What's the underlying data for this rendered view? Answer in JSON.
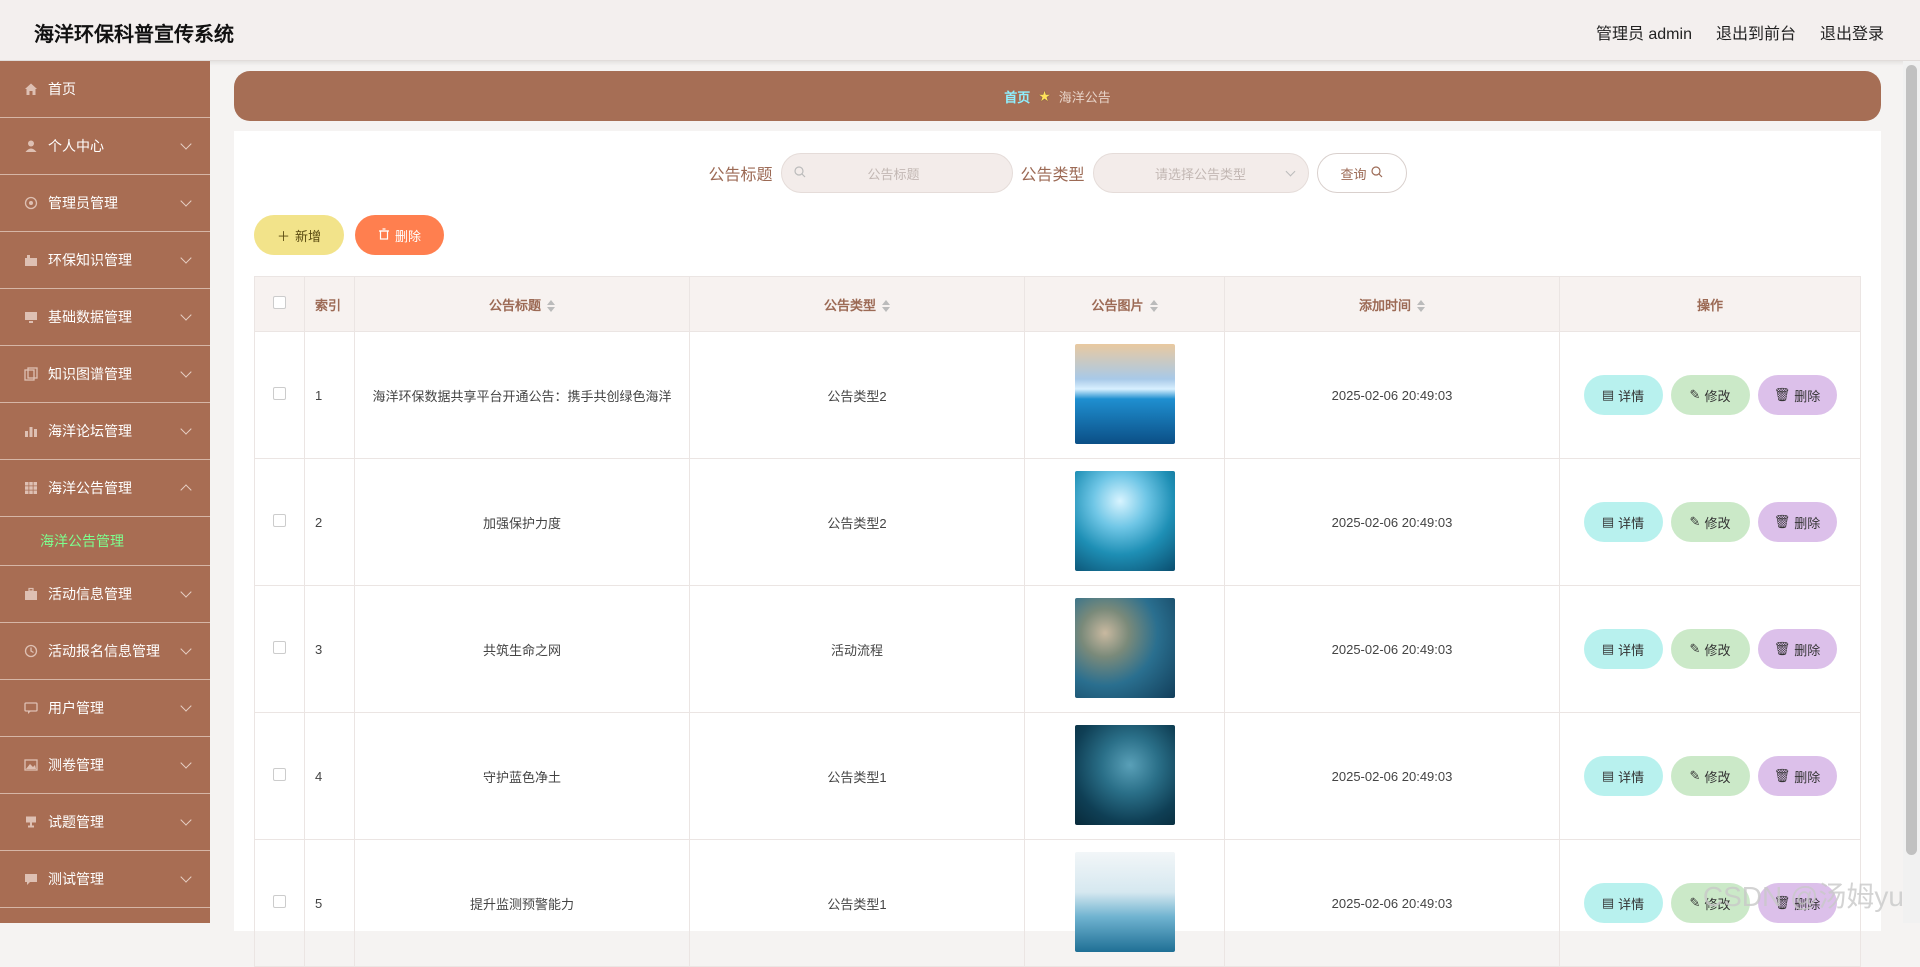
{
  "header": {
    "app_title": "海洋环保科普宣传系统",
    "links": [
      "管理员 admin",
      "退出到前台",
      "退出登录"
    ]
  },
  "sidebar": {
    "items": [
      {
        "label": "首页",
        "icon": "home-icon",
        "expandable": false
      },
      {
        "label": "个人中心",
        "icon": "user-icon",
        "expandable": true
      },
      {
        "label": "管理员管理",
        "icon": "admin-icon",
        "expandable": true
      },
      {
        "label": "环保知识管理",
        "icon": "knowledge-icon",
        "expandable": true
      },
      {
        "label": "基础数据管理",
        "icon": "monitor-icon",
        "expandable": true
      },
      {
        "label": "知识图谱管理",
        "icon": "copy-icon",
        "expandable": true
      },
      {
        "label": "海洋论坛管理",
        "icon": "bar-chart-icon",
        "expandable": true
      },
      {
        "label": "海洋公告管理",
        "icon": "grid-icon",
        "expandable": true,
        "expanded": true
      },
      {
        "label": "活动信息管理",
        "icon": "briefcase-icon",
        "expandable": true
      },
      {
        "label": "活动报名信息管理",
        "icon": "clock-icon",
        "expandable": true
      },
      {
        "label": "用户管理",
        "icon": "chat-icon",
        "expandable": true
      },
      {
        "label": "测卷管理",
        "icon": "picture-icon",
        "expandable": true
      },
      {
        "label": "试题管理",
        "icon": "cup-icon",
        "expandable": true
      },
      {
        "label": "测试管理",
        "icon": "message-icon",
        "expandable": true
      }
    ],
    "active_sub": "海洋公告管理"
  },
  "breadcrumb": {
    "home": "首页",
    "current": "海洋公告"
  },
  "search": {
    "title_label": "公告标题",
    "title_placeholder": "公告标题",
    "type_label": "公告类型",
    "type_placeholder": "请选择公告类型",
    "query_label": "查询"
  },
  "actions": {
    "add_label": "新增",
    "delete_label": "删除"
  },
  "table": {
    "headers": {
      "index": "索引",
      "title": "公告标题",
      "type": "公告类型",
      "image": "公告图片",
      "time": "添加时间",
      "ops": "操作"
    },
    "op_labels": {
      "detail": "详情",
      "edit": "修改",
      "remove": "删除"
    },
    "rows": [
      {
        "index": "1",
        "title": "海洋环保数据共享平台开通公告：携手共创绿色海洋",
        "type": "公告类型2",
        "time": "2025-02-06 20:49:03"
      },
      {
        "index": "2",
        "title": "加强保护力度",
        "type": "公告类型2",
        "time": "2025-02-06 20:49:03"
      },
      {
        "index": "3",
        "title": "共筑生命之网",
        "type": "活动流程",
        "time": "2025-02-06 20:49:03"
      },
      {
        "index": "4",
        "title": "守护蓝色净土",
        "type": "公告类型1",
        "time": "2025-02-06 20:49:03"
      },
      {
        "index": "5",
        "title": "提升监测预警能力",
        "type": "公告类型1",
        "time": "2025-02-06 20:49:03"
      }
    ]
  },
  "watermark": "CSDN @汤姆yu"
}
